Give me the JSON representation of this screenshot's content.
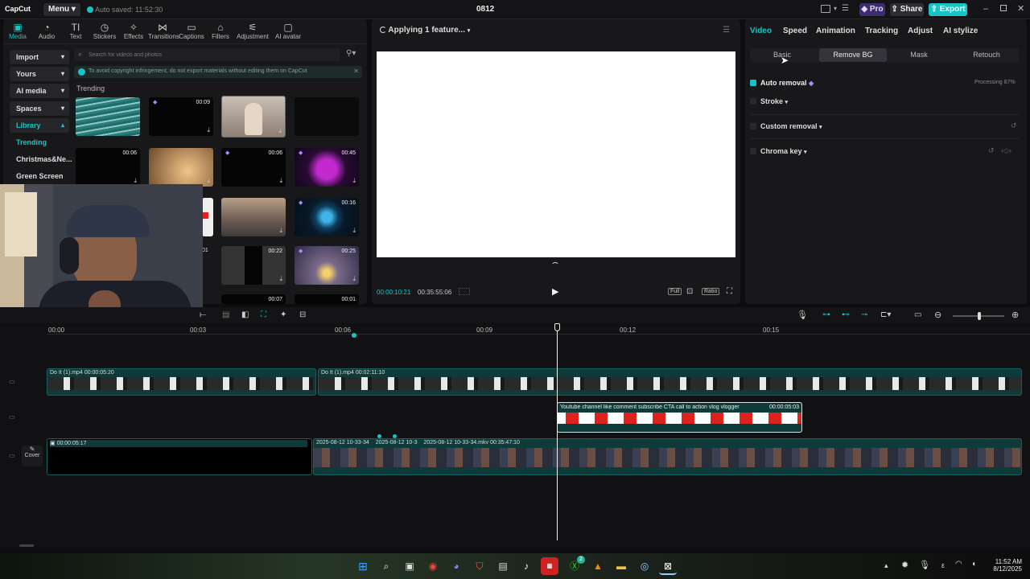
{
  "title_bar": {
    "app_name": "CapCut",
    "menu_label": "Menu",
    "autosave": "Auto saved: 11:52:30",
    "project_name": "0812",
    "pro_label": "Pro",
    "share_label": "Share",
    "export_label": "Export"
  },
  "toolbar": {
    "items": [
      "Media",
      "Audio",
      "Text",
      "Stickers",
      "Effects",
      "Transitions",
      "Captions",
      "Filters",
      "Adjustment",
      "AI avatar"
    ]
  },
  "media_sidebar": {
    "items": [
      "Import",
      "Yours",
      "AI media",
      "Spaces",
      "Library",
      "Trending",
      "Christmas&Ne...",
      "Green Screen"
    ]
  },
  "media": {
    "search_placeholder": "Search for videos and photos",
    "notice": "To avoid copyright infringement, do not export materials without editing them on CapCut",
    "section_title": "Trending",
    "durations": [
      "00:09",
      "00:06",
      "00:06",
      "00:45",
      "00:16",
      "00:22",
      "00:25",
      "00:07",
      "00:01",
      "01"
    ]
  },
  "player": {
    "status": "Applying 1 feature...",
    "current_time": "00:00:10:21",
    "total_time": "00:35:55:06",
    "full_label": "Full",
    "ratio_label": "Ratio"
  },
  "inspector": {
    "tabs": [
      "Video",
      "Speed",
      "Animation",
      "Tracking",
      "Adjust",
      "AI stylize"
    ],
    "subtabs": [
      "Basic",
      "Remove BG",
      "Mask",
      "Retouch"
    ],
    "auto_removal": "Auto removal",
    "processing": "Processing 87%",
    "stroke": "Stroke",
    "custom_removal": "Custom removal",
    "chroma_key": "Chroma key"
  },
  "timeline": {
    "ruler": [
      "00:00",
      "00:03",
      "00:06",
      "00:09",
      "00:12",
      "00:15"
    ],
    "clip1_label": "Do It (1).mp4",
    "clip1_duration": "00:00:05:20",
    "clip2_label": "Do It (1).mp4",
    "clip2_duration": "00:02:11:10",
    "overlay_label": "Youtube channel like comment subscribe CTA call to action vlog vlogger",
    "overlay_duration": "00:00:05:03",
    "main_duration": "00:00:05:17",
    "cover_label": "Cover",
    "rec_a": "2025-08-12 10-33-34",
    "rec_b": "2025-08-12 10-3",
    "rec_c": "2025-08-12 10-33-34.mkv",
    "rec_c_duration": "00:35:47:10"
  },
  "taskbar": {
    "time": "11:52 AM",
    "date": "8/12/2025",
    "badge": "2"
  }
}
